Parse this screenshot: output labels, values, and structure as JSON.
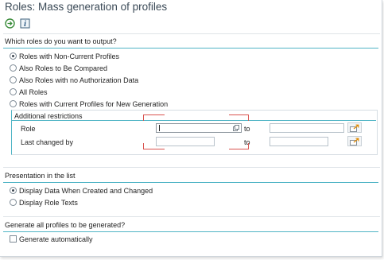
{
  "title": "Roles: Mass generation of profiles",
  "toolbar": {
    "execute_icon": "execute-icon",
    "info_icon": "information-icon"
  },
  "sections": {
    "output": {
      "header": "Which roles do you want to output?",
      "options": [
        {
          "label": "Roles with Non-Current Profiles",
          "checked": true
        },
        {
          "label": "Also Roles to Be Compared",
          "checked": false
        },
        {
          "label": "Also Roles with no Authorization Data",
          "checked": false
        },
        {
          "label": "All Roles",
          "checked": false
        },
        {
          "label": "Roles with Current Profiles for New Generation",
          "checked": false
        }
      ],
      "restrictions": {
        "title": "Additional restrictions",
        "rows": [
          {
            "label": "Role",
            "from_value": "",
            "to_label": "to",
            "to_value": ""
          },
          {
            "label": "Last changed by",
            "from_value": "",
            "to_label": "to",
            "to_value": ""
          }
        ]
      }
    },
    "presentation": {
      "header": "Presentation in the list",
      "options": [
        {
          "label": "Display Data When Created and Changed",
          "checked": true
        },
        {
          "label": "Display Role Texts",
          "checked": false
        }
      ]
    },
    "generate": {
      "header": "Generate all profiles to be generated?",
      "checkbox": {
        "label": "Generate automatically",
        "checked": false
      }
    }
  },
  "colors": {
    "accent_line": "#4fb4c5",
    "highlight_bracket": "#d9534f",
    "title_text": "#3b4a57"
  }
}
